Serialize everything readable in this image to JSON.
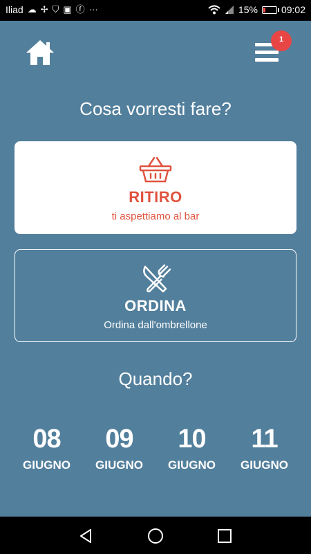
{
  "status_bar": {
    "carrier": "Iliad",
    "battery_percent_label": "15%",
    "battery_level": 0.15,
    "time": "09:02",
    "icons": [
      "cloud-icon",
      "fan-icon",
      "shield-icon",
      "photo-icon",
      "facebook-icon",
      "more-dots-icon",
      "wifi-icon",
      "sim-signal-icon",
      "battery-icon"
    ]
  },
  "header": {
    "home_icon": "home-icon",
    "menu_icon": "hamburger-menu-icon",
    "notification_count": "1"
  },
  "main": {
    "question": "Cosa vorresti fare?",
    "options": [
      {
        "icon": "shopping-basket-icon",
        "title": "RITIRO",
        "subtitle": "ti aspettiamo al bar"
      },
      {
        "icon": "fork-knife-icon",
        "title": "ORDINA",
        "subtitle": "Ordina dall'ombrellone"
      }
    ],
    "when_question": "Quando?",
    "dates": [
      {
        "day": "08",
        "month": "GIUGNO"
      },
      {
        "day": "09",
        "month": "GIUGNO"
      },
      {
        "day": "10",
        "month": "GIUGNO"
      },
      {
        "day": "11",
        "month": "GIUGNO"
      }
    ]
  },
  "colors": {
    "background": "#527f9c",
    "accent": "#e0533f",
    "badge": "#e84545",
    "card": "#ffffff"
  },
  "nav_bar": {
    "icons": [
      "back-icon",
      "home-circle-icon",
      "recents-icon"
    ]
  }
}
